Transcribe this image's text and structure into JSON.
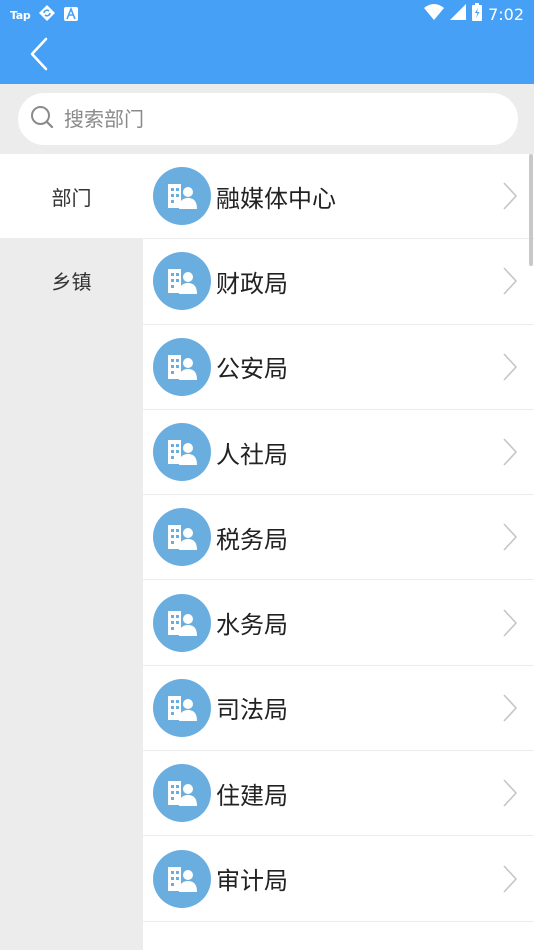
{
  "status_bar": {
    "app_label": "Tap",
    "time": "7:02"
  },
  "search": {
    "placeholder": "搜索部门"
  },
  "sidebar": {
    "items": [
      {
        "label": "部门",
        "active": true
      },
      {
        "label": "乡镇",
        "active": false
      }
    ]
  },
  "departments": [
    {
      "label": "融媒体中心"
    },
    {
      "label": "财政局"
    },
    {
      "label": "公安局"
    },
    {
      "label": "人社局"
    },
    {
      "label": "税务局"
    },
    {
      "label": "水务局"
    },
    {
      "label": "司法局"
    },
    {
      "label": "住建局"
    },
    {
      "label": "审计局"
    }
  ],
  "colors": {
    "app_bar": "#46a0f5",
    "avatar": "#6aaee0",
    "background": "#ececec"
  },
  "icons": {
    "back": "chevron-left-icon",
    "search": "search-icon",
    "department": "building-person-icon",
    "row_arrow": "chevron-right-icon"
  }
}
